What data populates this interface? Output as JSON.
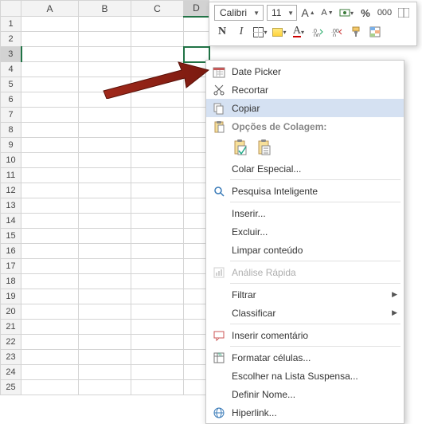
{
  "columns": [
    "A",
    "B",
    "C",
    "D"
  ],
  "rows": [
    "1",
    "2",
    "3",
    "4",
    "5",
    "6",
    "7",
    "8",
    "9",
    "10",
    "11",
    "12",
    "13",
    "14",
    "15",
    "16",
    "17",
    "18",
    "19",
    "20",
    "21",
    "22",
    "23",
    "24",
    "25"
  ],
  "selected": {
    "col": "D",
    "row": "3"
  },
  "mini_toolbar": {
    "font_name": "Calibri",
    "font_size": "11",
    "grow": "A",
    "shrink": "A",
    "percent": "%",
    "group": "000",
    "bold": "N",
    "italic": "I"
  },
  "context_menu": {
    "date_picker": "Date Picker",
    "cut": "Recortar",
    "copy": "Copiar",
    "paste_options_header": "Opções de Colagem:",
    "paste_special": "Colar Especial...",
    "smart_lookup": "Pesquisa Inteligente",
    "insert": "Inserir...",
    "delete": "Excluir...",
    "clear_contents": "Limpar conteúdo",
    "quick_analysis": "Análise Rápida",
    "filter": "Filtrar",
    "sort": "Classificar",
    "insert_comment": "Inserir comentário",
    "format_cells": "Formatar células...",
    "pick_list": "Escolher na Lista Suspensa...",
    "define_name": "Definir Nome...",
    "hyperlink": "Hiperlink..."
  }
}
